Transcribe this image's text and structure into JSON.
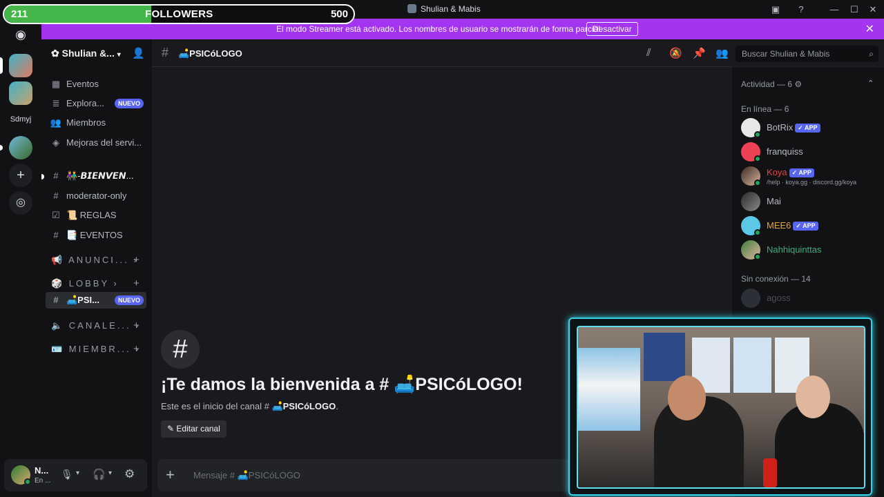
{
  "followers": {
    "current": "211",
    "label": "FOLLOWERS",
    "goal": "500",
    "progress": 0.42
  },
  "window": {
    "title": "Shulian & Mabis"
  },
  "banner": {
    "text": "El modo Streamer está activado. Los nombres de usuario se mostrarán de forma parcial.",
    "button": "Desactivar"
  },
  "rail": {
    "server_label": "Sdmyj"
  },
  "server": {
    "name": "Shulian &..."
  },
  "nav": [
    {
      "label": "Eventos"
    },
    {
      "label": "Explora...",
      "badge": "NUEVO"
    },
    {
      "label": "Miembros"
    },
    {
      "label": "Mejoras del servi..."
    }
  ],
  "channels": [
    {
      "label": "👫-𝘽𝙄𝙀𝙉𝙑𝙀𝙉..."
    },
    {
      "label": "moderator-only"
    },
    {
      "label": "📜 REGLAS"
    },
    {
      "label": "📑 EVENTOS"
    }
  ],
  "categories": [
    {
      "label": "📢 ANUNCI..."
    },
    {
      "label": "🎲 LOBBY"
    },
    {
      "label": "🔈 CANALE..."
    },
    {
      "label": "🪪 MIEMBR..."
    }
  ],
  "active_channel": {
    "label": "🛋️PSI...",
    "badge": "NUEVO"
  },
  "user": {
    "name": "N...",
    "status": "En ..."
  },
  "header": {
    "channel": "🛋️PSICóLOGO",
    "search_placeholder": "Buscar Shulian & Mabis"
  },
  "welcome": {
    "title": "¡Te damos la bienvenida a # 🛋️PSICóLOGO!",
    "subtitle_prefix": "Este es el inicio del canal #",
    "subtitle_channel": "🛋️PSICóLOGO",
    "subtitle_suffix": ".",
    "edit_button": "Editar canal"
  },
  "composer": {
    "placeholder": "Mensaje # 🛋️PSICóLOGO"
  },
  "members": {
    "activity": "Actividad — 6",
    "online_header": "En línea — 6",
    "offline_header": "Sin conexión — 14",
    "online": [
      {
        "name": "BotRix",
        "app": "✓ APP",
        "color": "#b5bac1"
      },
      {
        "name": "franquiss",
        "color": "#b5bac1"
      },
      {
        "name": "Koya",
        "app": "✓ APP",
        "sub": "/help · koya.gg · discord.gg/koya",
        "color": "#e04444"
      },
      {
        "name": "Mai",
        "color": "#b5bac1"
      },
      {
        "name": "MEE6",
        "app": "✓ APP",
        "color": "#e6a23c"
      },
      {
        "name": "Nahhiquinttas",
        "color": "#3fae7a"
      }
    ],
    "offline": [
      {
        "name": "agoss"
      }
    ]
  }
}
